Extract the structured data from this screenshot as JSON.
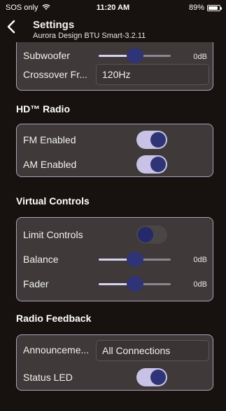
{
  "status": {
    "carrier": "SOS only",
    "time": "11:20 AM",
    "battery": "89%",
    "battery_level": 0.89
  },
  "header": {
    "title": "Settings",
    "subtitle": "Aurora Design BTU Smart-3.2.11"
  },
  "icons": {
    "back": "chevron-left-icon",
    "wifi": "wifi-icon",
    "battery": "battery-icon"
  },
  "audio": {
    "subwoofer_label": "Subwoofer",
    "subwoofer_value": "0dB",
    "subwoofer_level": 0.5,
    "crossover_label": "Crossover Fr...",
    "crossover_value": "120Hz"
  },
  "hd_radio": {
    "title": "HD™ Radio",
    "fm_label": "FM Enabled",
    "fm_on": true,
    "am_label": "AM Enabled",
    "am_on": true
  },
  "virtual_controls": {
    "title": "Virtual Controls",
    "limit_label": "Limit Controls",
    "limit_on": false,
    "balance_label": "Balance",
    "balance_value": "0dB",
    "balance_level": 0.5,
    "fader_label": "Fader",
    "fader_value": "0dB",
    "fader_level": 0.5
  },
  "radio_feedback": {
    "title": "Radio Feedback",
    "announcement_label": "Announceme...",
    "announcement_value": "All Connections",
    "led_label": "Status LED",
    "led_on": true
  },
  "colors": {
    "toggle_on": "#c8c3e6",
    "knob": "#2e3475",
    "card_border": "#a9a2bb",
    "card_bg": "#3f3939"
  }
}
